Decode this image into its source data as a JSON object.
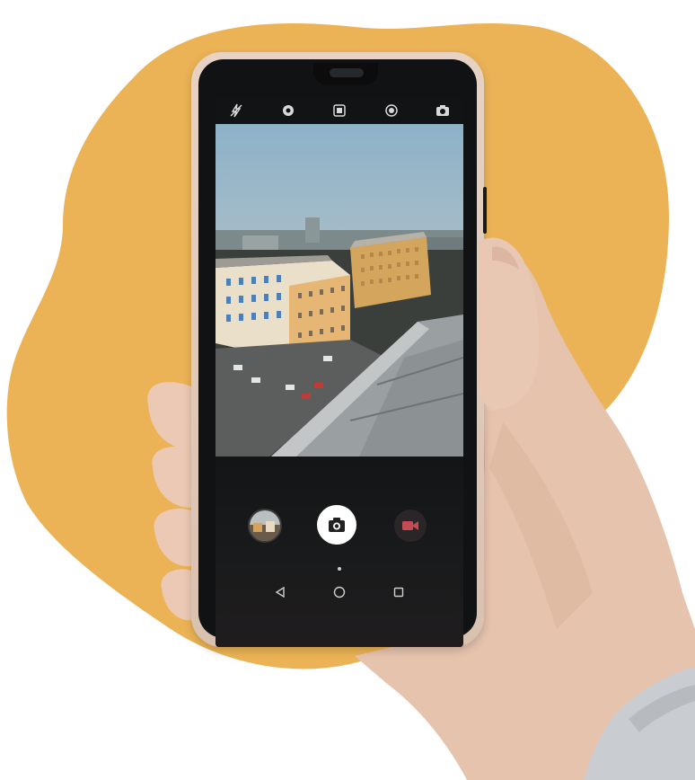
{
  "colors": {
    "blob": "#ebb356",
    "phone_case": "#decabb",
    "skin": "#e9c8b3",
    "sky": "#8fb3c9",
    "background": "#ffffff"
  },
  "camera_app": {
    "top_icons": [
      "flash-off-icon",
      "aperture-icon",
      "filter-icon",
      "mode-icon",
      "switch-camera-icon"
    ],
    "controls": [
      "gallery-thumbnail",
      "camera-icon",
      "video-camera-icon"
    ],
    "nav_icons": [
      "back-triangle-icon",
      "home-circle-icon",
      "recents-square-icon"
    ]
  }
}
